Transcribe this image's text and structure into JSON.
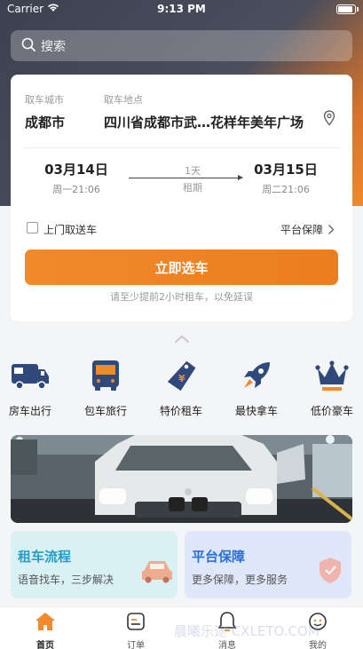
{
  "status_bar": {
    "carrier": "Carrier",
    "time": "9:13 PM"
  },
  "search": {
    "placeholder": "搜索"
  },
  "booking": {
    "city_label": "取车城市",
    "city_value": "成都市",
    "location_label": "取车地点",
    "location_value": "四川省成都市武…花样年美年广场",
    "pickup_date": "03月14日",
    "pickup_time": "周一21:06",
    "duration_value": "1天",
    "duration_label": "租期",
    "return_date": "03月15日",
    "return_time": "周二21:06",
    "door_delivery_label": "上门取送车",
    "door_delivery_checked": false,
    "platform_guarantee": "平台保障",
    "select_button": "立即选车",
    "tip": "请至少提前2小时租车，以免延误"
  },
  "categories": [
    {
      "label": "房车出行",
      "icon": "rv-icon"
    },
    {
      "label": "包车旅行",
      "icon": "bus-icon"
    },
    {
      "label": "特价租车",
      "icon": "discount-tag-icon"
    },
    {
      "label": "最快拿车",
      "icon": "rocket-icon"
    },
    {
      "label": "低价豪车",
      "icon": "crown-icon"
    }
  ],
  "promos": [
    {
      "title": "租车流程",
      "subtitle": "语音找车，三步解决",
      "color": "#2a9cc4"
    },
    {
      "title": "平台保障",
      "subtitle": "更多保障，更多服务",
      "color": "#2c6ed8"
    }
  ],
  "tabs": [
    {
      "label": "首页",
      "icon": "home-icon",
      "active": true
    },
    {
      "label": "订单",
      "icon": "order-icon",
      "active": false
    },
    {
      "label": "消息",
      "icon": "bell-icon",
      "active": false
    },
    {
      "label": "我的",
      "icon": "profile-icon",
      "active": false
    }
  ],
  "watermark": "晨曦乐途·CXLETO.COM",
  "colors": {
    "accent": "#f08a2c",
    "nav_blue": "#2f4a7a"
  }
}
